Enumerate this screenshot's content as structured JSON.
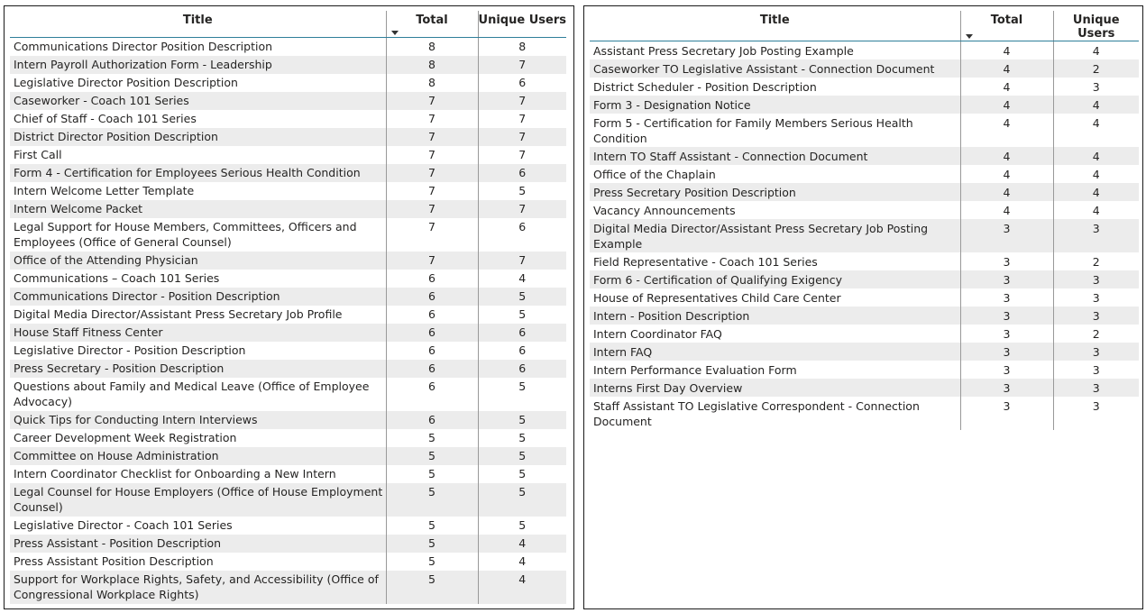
{
  "columns": {
    "title": "Title",
    "total": "Total",
    "users": "Unique Users"
  },
  "left_table": [
    {
      "title": "Communications Director Position Description",
      "total": "8",
      "users": "8"
    },
    {
      "title": "Intern Payroll Authorization Form - Leadership",
      "total": "8",
      "users": "7"
    },
    {
      "title": "Legislative Director Position Description",
      "total": "8",
      "users": "6"
    },
    {
      "title": "Caseworker - Coach 101 Series",
      "total": "7",
      "users": "7"
    },
    {
      "title": "Chief of Staff - Coach 101 Series",
      "total": "7",
      "users": "7"
    },
    {
      "title": "District Director Position Description",
      "total": "7",
      "users": "7"
    },
    {
      "title": "First Call",
      "total": "7",
      "users": "7"
    },
    {
      "title": "Form 4 - Certification for Employees Serious Health Condition",
      "total": "7",
      "users": "6"
    },
    {
      "title": "Intern Welcome Letter Template",
      "total": "7",
      "users": "5"
    },
    {
      "title": "Intern Welcome Packet",
      "total": "7",
      "users": "7"
    },
    {
      "title": "Legal Support for House Members, Committees, Officers and Employees (Office of General Counsel)",
      "total": "7",
      "users": "6"
    },
    {
      "title": "Office of the Attending Physician",
      "total": "7",
      "users": "7"
    },
    {
      "title": "Communications – Coach 101 Series",
      "total": "6",
      "users": "4"
    },
    {
      "title": "Communications Director - Position Description",
      "total": "6",
      "users": "5"
    },
    {
      "title": "Digital Media Director/Assistant Press Secretary Job Profile",
      "total": "6",
      "users": "5"
    },
    {
      "title": "House Staff Fitness Center",
      "total": "6",
      "users": "6"
    },
    {
      "title": "Legislative Director - Position Description",
      "total": "6",
      "users": "6"
    },
    {
      "title": "Press Secretary - Position Description",
      "total": "6",
      "users": "6"
    },
    {
      "title": "Questions about Family and Medical Leave (Office of Employee Advocacy)",
      "total": "6",
      "users": "5"
    },
    {
      "title": "Quick Tips for Conducting Intern Interviews",
      "total": "6",
      "users": "5"
    },
    {
      "title": "Career Development Week Registration",
      "total": "5",
      "users": "5"
    },
    {
      "title": "Committee on House Administration",
      "total": "5",
      "users": "5"
    },
    {
      "title": "Intern Coordinator Checklist for Onboarding a New Intern",
      "total": "5",
      "users": "5"
    },
    {
      "title": "Legal Counsel for House Employers (Office of House Employment Counsel)",
      "total": "5",
      "users": "5"
    },
    {
      "title": "Legislative Director - Coach 101 Series",
      "total": "5",
      "users": "5"
    },
    {
      "title": "Press Assistant - Position Description",
      "total": "5",
      "users": "4"
    },
    {
      "title": "Press Assistant Position Description",
      "total": "5",
      "users": "4"
    },
    {
      "title": "Support for Workplace Rights, Safety, and Accessibility (Office of Congressional Workplace Rights)",
      "total": "5",
      "users": "4"
    }
  ],
  "right_table": [
    {
      "title": "Assistant Press Secretary Job Posting Example",
      "total": "4",
      "users": "4"
    },
    {
      "title": "Caseworker TO Legislative Assistant - Connection Document",
      "total": "4",
      "users": "2"
    },
    {
      "title": "District Scheduler - Position Description",
      "total": "4",
      "users": "3"
    },
    {
      "title": "Form 3 - Designation Notice",
      "total": "4",
      "users": "4"
    },
    {
      "title": "Form 5 - Certification for Family Members Serious Health Condition",
      "total": "4",
      "users": "4"
    },
    {
      "title": "Intern TO Staff Assistant - Connection Document",
      "total": "4",
      "users": "4"
    },
    {
      "title": "Office of the Chaplain",
      "total": "4",
      "users": "4"
    },
    {
      "title": "Press Secretary Position Description",
      "total": "4",
      "users": "4"
    },
    {
      "title": "Vacancy Announcements",
      "total": "4",
      "users": "4"
    },
    {
      "title": "Digital Media Director/Assistant Press Secretary Job Posting Example",
      "total": "3",
      "users": "3"
    },
    {
      "title": "Field Representative - Coach 101 Series",
      "total": "3",
      "users": "2"
    },
    {
      "title": "Form 6 - Certification of Qualifying Exigency",
      "total": "3",
      "users": "3"
    },
    {
      "title": "House of Representatives Child Care Center",
      "total": "3",
      "users": "3"
    },
    {
      "title": "Intern - Position Description",
      "total": "3",
      "users": "3"
    },
    {
      "title": "Intern Coordinator FAQ",
      "total": "3",
      "users": "2"
    },
    {
      "title": "Intern FAQ",
      "total": "3",
      "users": "3"
    },
    {
      "title": "Intern Performance Evaluation Form",
      "total": "3",
      "users": "3"
    },
    {
      "title": "Interns First Day Overview",
      "total": "3",
      "users": "3"
    },
    {
      "title": "Staff Assistant TO Legislative Correspondent - Connection Document",
      "total": "3",
      "users": "3"
    }
  ]
}
